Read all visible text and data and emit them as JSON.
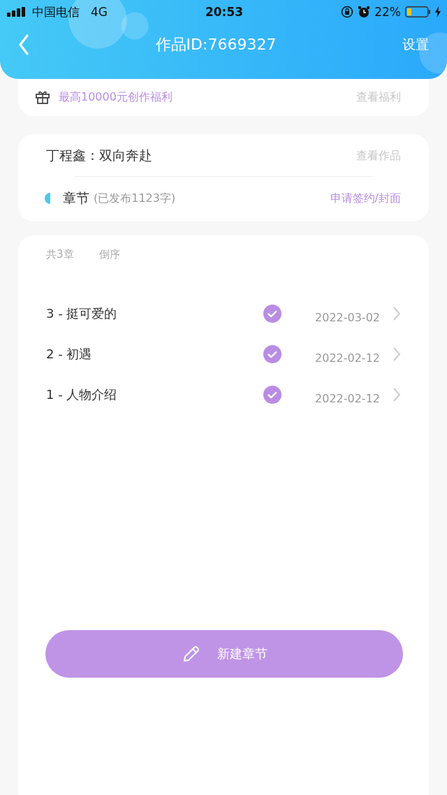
{
  "status_bar": {
    "carrier": "中国电信",
    "network": "4G",
    "time": "20:53",
    "battery": "22%"
  },
  "nav": {
    "title": "作品ID:7669327",
    "action": "设置"
  },
  "benefit": {
    "text": "最高10000元创作福利",
    "link": "查看福利"
  },
  "work": {
    "title": "丁程鑫：双向奔赴",
    "link": "查看作品",
    "section": "章节",
    "section_note": "(已发布1123字)",
    "action": "申请签约/封面"
  },
  "chapters": {
    "count": "共3章",
    "sort": "倒序",
    "items": [
      {
        "title": "3 - 挺可爱的",
        "published": true,
        "date": "2022-03-02"
      },
      {
        "title": "2 - 初遇",
        "published": true,
        "date": "2022-02-12"
      },
      {
        "title": "1 - 人物介绍",
        "published": true,
        "date": "2022-02-12"
      }
    ]
  },
  "new_button": "新建章节"
}
